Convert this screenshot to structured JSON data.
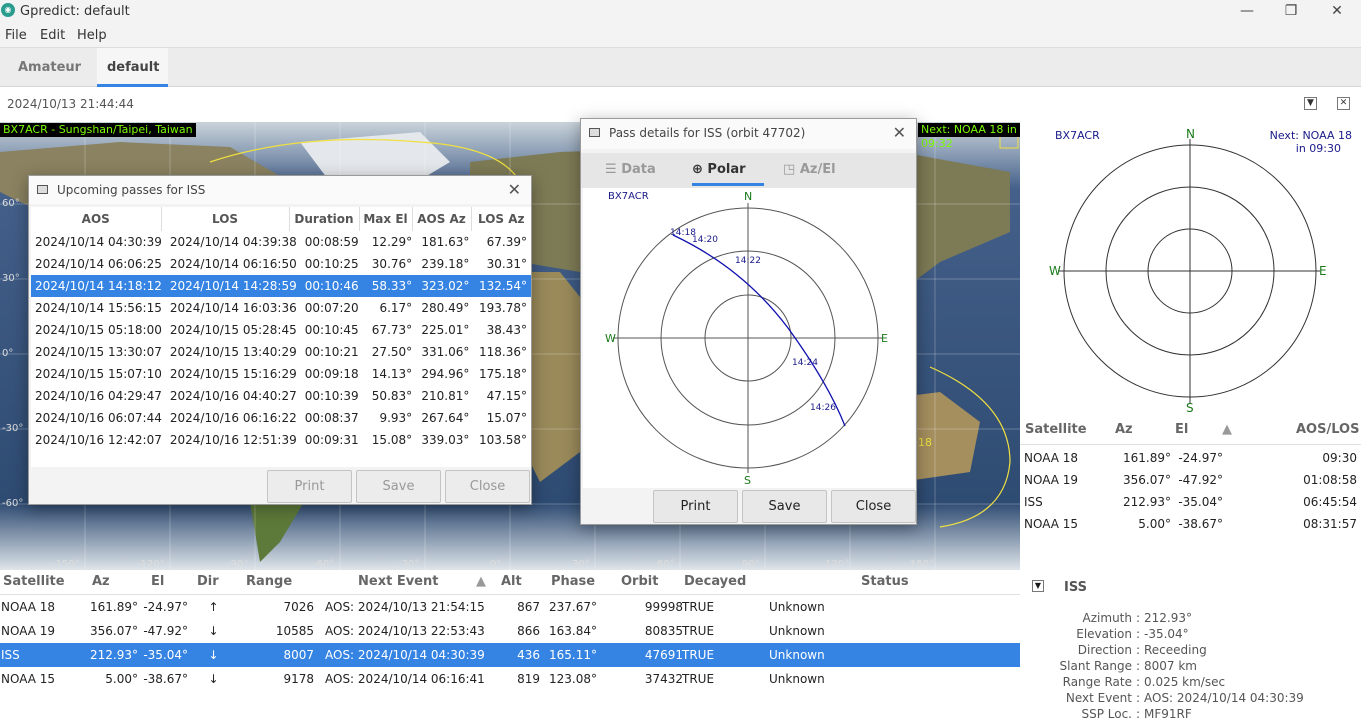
{
  "window": {
    "title": "Gpredict: default",
    "icon": "gpredict-icon"
  },
  "menu": [
    "File",
    "Edit",
    "Help"
  ],
  "tabs": [
    "Amateur",
    "default"
  ],
  "datetime": "2024/10/13 21:44:44",
  "map": {
    "qth_label": "BX7ACR - Sungshan/Taipei, Taiwan",
    "next_label": "Next: NOAA 18 in 09:32",
    "sat_label": "18",
    "lat_labels": [
      "60°",
      "30°",
      "0°",
      "-30°",
      "-60°"
    ],
    "lon_labels": [
      "-150°",
      "-120°",
      "-90°",
      "-60°",
      "-30°",
      "0°",
      "30°",
      "60°",
      "90°",
      "120°",
      "150°"
    ]
  },
  "passes_dialog": {
    "title": "Upcoming passes for ISS",
    "columns": [
      "AOS",
      "LOS",
      "Duration",
      "Max El",
      "AOS Az",
      "LOS Az"
    ],
    "rows": [
      [
        "2024/10/14 04:30:39",
        "2024/10/14 04:39:38",
        "00:08:59",
        "12.29°",
        "181.63°",
        "67.39°"
      ],
      [
        "2024/10/14 06:06:25",
        "2024/10/14 06:16:50",
        "00:10:25",
        "30.76°",
        "239.18°",
        "30.31°"
      ],
      [
        "2024/10/14 14:18:12",
        "2024/10/14 14:28:59",
        "00:10:46",
        "58.33°",
        "323.02°",
        "132.54°"
      ],
      [
        "2024/10/14 15:56:15",
        "2024/10/14 16:03:36",
        "00:07:20",
        "6.17°",
        "280.49°",
        "193.78°"
      ],
      [
        "2024/10/15 05:18:00",
        "2024/10/15 05:28:45",
        "00:10:45",
        "67.73°",
        "225.01°",
        "38.43°"
      ],
      [
        "2024/10/15 13:30:07",
        "2024/10/15 13:40:29",
        "00:10:21",
        "27.50°",
        "331.06°",
        "118.36°"
      ],
      [
        "2024/10/15 15:07:10",
        "2024/10/15 15:16:29",
        "00:09:18",
        "14.13°",
        "294.96°",
        "175.18°"
      ],
      [
        "2024/10/16 04:29:47",
        "2024/10/16 04:40:27",
        "00:10:39",
        "50.83°",
        "210.81°",
        "47.15°"
      ],
      [
        "2024/10/16 06:07:44",
        "2024/10/16 06:16:22",
        "00:08:37",
        "9.93°",
        "267.64°",
        "15.07°"
      ],
      [
        "2024/10/16 12:42:07",
        "2024/10/16 12:51:39",
        "00:09:31",
        "15.08°",
        "339.03°",
        "103.58°"
      ]
    ],
    "selected_row": 2,
    "buttons": [
      "Print",
      "Save",
      "Close"
    ]
  },
  "pass_details": {
    "title": "Pass details for ISS (orbit 47702)",
    "tabs": [
      "Data",
      "Polar",
      "Az/El"
    ],
    "qth": "BX7ACR",
    "dirs": {
      "n": "N",
      "s": "S",
      "e": "E",
      "w": "W"
    },
    "time_labels": [
      "14:18",
      "14:20",
      "14:22",
      "14:24",
      "14:26"
    ],
    "buttons": [
      "Print",
      "Save",
      "Close"
    ]
  },
  "polar_view": {
    "qth": "BX7ACR",
    "next_line1": "Next: NOAA 18",
    "next_line2": "in 09:30",
    "dirs": {
      "n": "N",
      "s": "S",
      "e": "E",
      "w": "W"
    }
  },
  "sat_list": {
    "columns": [
      "Satellite",
      "Az",
      "El",
      "AOS/LOS"
    ],
    "rows": [
      [
        "NOAA 18",
        "161.89°",
        "-24.97°",
        "09:30"
      ],
      [
        "NOAA 19",
        "356.07°",
        "-47.92°",
        "01:08:58"
      ],
      [
        "ISS",
        "212.93°",
        "-35.04°",
        "06:45:54"
      ],
      [
        "NOAA 15",
        "5.00°",
        "-38.67°",
        "08:31:57"
      ]
    ]
  },
  "main_table": {
    "columns": [
      "Satellite",
      "Az",
      "El",
      "Dir",
      "Range",
      "Next Event",
      "Alt",
      "Phase",
      "Orbit",
      "Decayed",
      "Status"
    ],
    "rows": [
      [
        "NOAA 18",
        "161.89°",
        "-24.97°",
        "↑",
        "7026",
        "AOS: 2024/10/13 21:54:15",
        "867",
        "237.67°",
        "99998",
        "TRUE",
        "Unknown"
      ],
      [
        "NOAA 19",
        "356.07°",
        "-47.92°",
        "↓",
        "10585",
        "AOS: 2024/10/13 22:53:43",
        "866",
        "163.84°",
        "80835",
        "TRUE",
        "Unknown"
      ],
      [
        "ISS",
        "212.93°",
        "-35.04°",
        "↓",
        "8007",
        "AOS: 2024/10/14 04:30:39",
        "436",
        "165.11°",
        "47691",
        "TRUE",
        "Unknown"
      ],
      [
        "NOAA 15",
        "5.00°",
        "-38.67°",
        "↓",
        "9178",
        "AOS: 2024/10/14 06:16:41",
        "819",
        "123.08°",
        "37432",
        "TRUE",
        "Unknown"
      ]
    ],
    "selected_row": 2
  },
  "details": {
    "sat": "ISS",
    "fields": [
      [
        "Azimuth",
        "212.93°"
      ],
      [
        "Elevation",
        "-35.04°"
      ],
      [
        "Direction",
        "Receeding"
      ],
      [
        "Slant Range",
        "8007 km"
      ],
      [
        "Range Rate",
        "0.025 km/sec"
      ],
      [
        "Next Event",
        "AOS: 2024/10/14 04:30:39"
      ],
      [
        "SSP Loc.",
        "MF91RF"
      ]
    ]
  }
}
